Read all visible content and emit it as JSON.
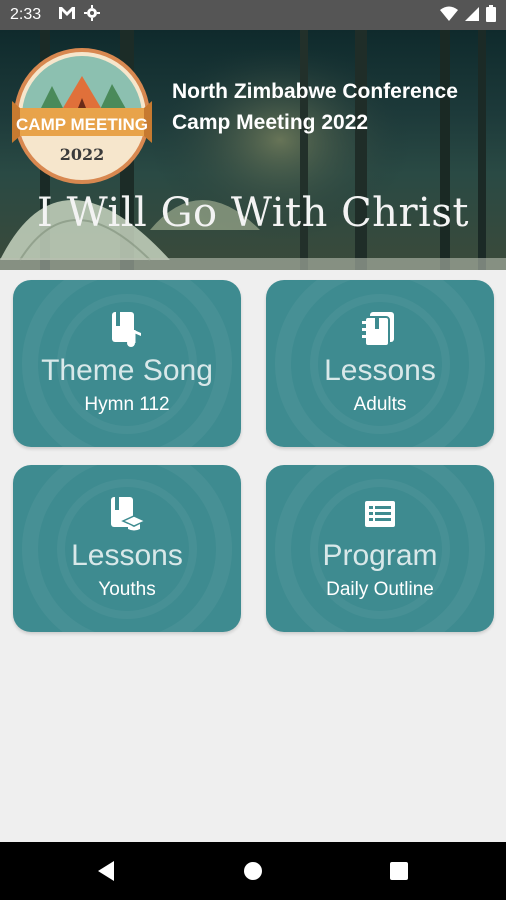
{
  "status": {
    "time": "2:33"
  },
  "banner": {
    "title_line1": "North Zimbabwe Conference",
    "title_line2": "Camp Meeting 2022",
    "motto": "I Will Go With Christ",
    "logo_text": "CAMP MEETING",
    "logo_year": "2022"
  },
  "cards": [
    {
      "title": "Theme Song",
      "subtitle": "Hymn 112",
      "icon": "music-book-icon"
    },
    {
      "title": "Lessons",
      "subtitle": "Adults",
      "icon": "notebook-icon"
    },
    {
      "title": "Lessons",
      "subtitle": "Youths",
      "icon": "graduation-book-icon"
    },
    {
      "title": "Program",
      "subtitle": "Daily Outline",
      "icon": "list-icon"
    }
  ],
  "colors": {
    "card": "#3e8b90",
    "background": "#efefef"
  }
}
